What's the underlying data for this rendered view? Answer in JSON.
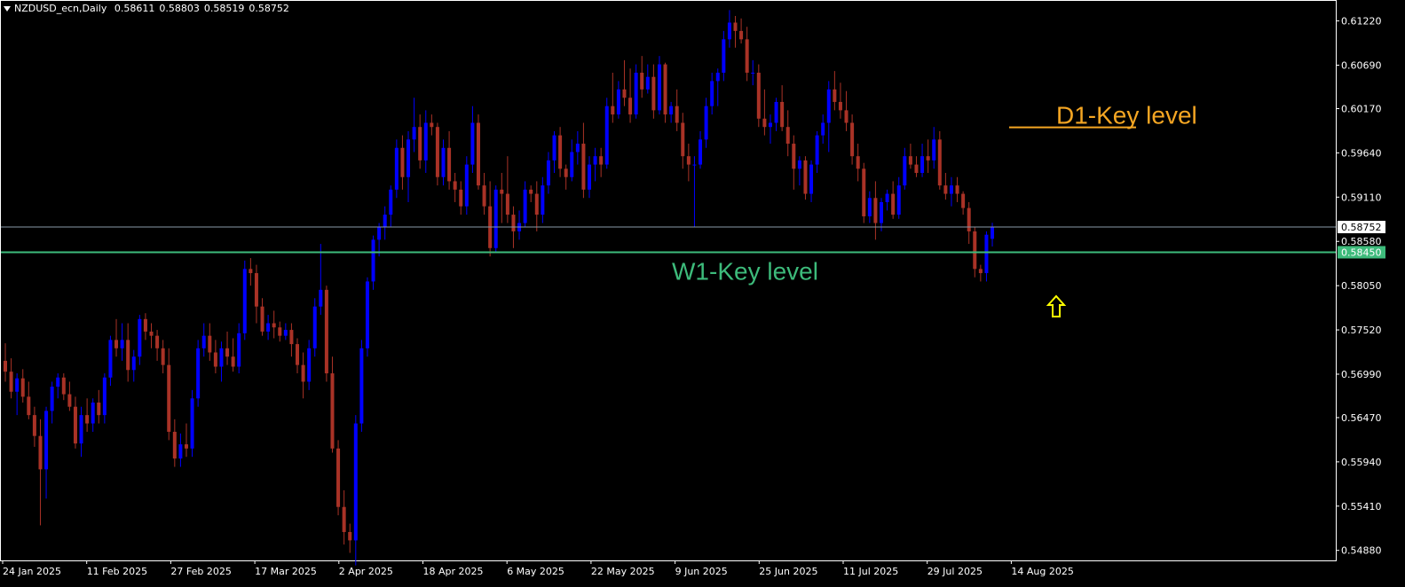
{
  "header": {
    "symbol": "NZDUSD_ecn,Daily",
    "open": "0.58611",
    "high": "0.58803",
    "low": "0.58519",
    "close": "0.58752"
  },
  "chart_data": {
    "type": "candlestick",
    "x_labels": [
      "24 Jan 2025",
      "11 Feb 2025",
      "27 Feb 2025",
      "17 Mar 2025",
      "2 Apr 2025",
      "18 Apr 2025",
      "6 May 2025",
      "22 May 2025",
      "9 Jun 2025",
      "25 Jun 2025",
      "11 Jul 2025",
      "29 Jul 2025",
      "14 Aug 2025"
    ],
    "y_ticks": [
      "0.61220",
      "0.60690",
      "0.60170",
      "0.59640",
      "0.59110",
      "0.58580",
      "0.58050",
      "0.57520",
      "0.56990",
      "0.56470",
      "0.55940",
      "0.55410",
      "0.54880"
    ],
    "ylim": [
      0.5476,
      0.6146
    ],
    "current_price": {
      "value": 0.58752,
      "label": "0.58752"
    },
    "levels": [
      {
        "label": "W1-Key level",
        "value": 0.5845,
        "price_label": "0.58450",
        "color": "#3dbb7b"
      },
      {
        "label": "D1-Key level",
        "value": 0.59946,
        "color": "#f5a623"
      }
    ],
    "colors": {
      "bull": "#0000ff",
      "bear": "#a93226",
      "background": "#000000",
      "text": "#ffffff",
      "arrow": "#ffff00"
    },
    "ohlc": [
      [
        0.5715,
        0.5736,
        0.569,
        0.5702
      ],
      [
        0.5702,
        0.5718,
        0.567,
        0.5678
      ],
      [
        0.5678,
        0.57,
        0.565,
        0.5694
      ],
      [
        0.5694,
        0.5705,
        0.5665,
        0.5672
      ],
      [
        0.5672,
        0.569,
        0.5645,
        0.565
      ],
      [
        0.565,
        0.566,
        0.5612,
        0.5625
      ],
      [
        0.5625,
        0.5645,
        0.5518,
        0.5585
      ],
      [
        0.5585,
        0.566,
        0.555,
        0.5655
      ],
      [
        0.5655,
        0.569,
        0.564,
        0.5684
      ],
      [
        0.5684,
        0.57,
        0.567,
        0.5695
      ],
      [
        0.5695,
        0.57,
        0.5668,
        0.5675
      ],
      [
        0.5675,
        0.569,
        0.5655,
        0.566
      ],
      [
        0.566,
        0.5672,
        0.561,
        0.5616
      ],
      [
        0.5616,
        0.566,
        0.56,
        0.565
      ],
      [
        0.565,
        0.567,
        0.563,
        0.564
      ],
      [
        0.564,
        0.567,
        0.563,
        0.5665
      ],
      [
        0.5665,
        0.568,
        0.564,
        0.565
      ],
      [
        0.565,
        0.57,
        0.564,
        0.5695
      ],
      [
        0.5695,
        0.5745,
        0.5685,
        0.574
      ],
      [
        0.574,
        0.5765,
        0.572,
        0.573
      ],
      [
        0.573,
        0.576,
        0.5715,
        0.574
      ],
      [
        0.574,
        0.576,
        0.569,
        0.5704
      ],
      [
        0.5704,
        0.5728,
        0.569,
        0.572
      ],
      [
        0.572,
        0.577,
        0.571,
        0.5765
      ],
      [
        0.5765,
        0.5772,
        0.574,
        0.575
      ],
      [
        0.575,
        0.576,
        0.573,
        0.5745
      ],
      [
        0.5745,
        0.5752,
        0.5715,
        0.573
      ],
      [
        0.573,
        0.574,
        0.57,
        0.571
      ],
      [
        0.571,
        0.573,
        0.562,
        0.563
      ],
      [
        0.563,
        0.5645,
        0.5588,
        0.5598
      ],
      [
        0.5598,
        0.5628,
        0.5588,
        0.5615
      ],
      [
        0.5615,
        0.564,
        0.56,
        0.561
      ],
      [
        0.561,
        0.568,
        0.56,
        0.567
      ],
      [
        0.567,
        0.574,
        0.566,
        0.573
      ],
      [
        0.573,
        0.576,
        0.572,
        0.5745
      ],
      [
        0.5745,
        0.576,
        0.5715,
        0.5725
      ],
      [
        0.5725,
        0.574,
        0.57,
        0.5708
      ],
      [
        0.5708,
        0.5738,
        0.569,
        0.573
      ],
      [
        0.573,
        0.575,
        0.571,
        0.572
      ],
      [
        0.572,
        0.5742,
        0.5702,
        0.5708
      ],
      [
        0.5708,
        0.576,
        0.57,
        0.5748
      ],
      [
        0.5748,
        0.5835,
        0.574,
        0.5825
      ],
      [
        0.5825,
        0.5838,
        0.5805,
        0.582
      ],
      [
        0.582,
        0.583,
        0.576,
        0.578
      ],
      [
        0.578,
        0.579,
        0.5745,
        0.575
      ],
      [
        0.575,
        0.577,
        0.574,
        0.576
      ],
      [
        0.576,
        0.5775,
        0.5742,
        0.5755
      ],
      [
        0.5755,
        0.5762,
        0.5738,
        0.5745
      ],
      [
        0.5745,
        0.576,
        0.574,
        0.5752
      ],
      [
        0.5752,
        0.576,
        0.572,
        0.5735
      ],
      [
        0.5735,
        0.5742,
        0.57,
        0.571
      ],
      [
        0.571,
        0.5725,
        0.567,
        0.569
      ],
      [
        0.569,
        0.574,
        0.568,
        0.573
      ],
      [
        0.573,
        0.579,
        0.572,
        0.578
      ],
      [
        0.578,
        0.5855,
        0.577,
        0.58
      ],
      [
        0.58,
        0.5805,
        0.569,
        0.57
      ],
      [
        0.57,
        0.572,
        0.5605,
        0.561
      ],
      [
        0.561,
        0.562,
        0.553,
        0.554
      ],
      [
        0.554,
        0.556,
        0.5495,
        0.551
      ],
      [
        0.551,
        0.552,
        0.5485,
        0.55
      ],
      [
        0.55,
        0.565,
        0.547,
        0.564
      ],
      [
        0.564,
        0.574,
        0.563,
        0.573
      ],
      [
        0.573,
        0.5815,
        0.572,
        0.581
      ],
      [
        0.581,
        0.5865,
        0.58,
        0.586
      ],
      [
        0.586,
        0.588,
        0.584,
        0.5875
      ],
      [
        0.5875,
        0.59,
        0.586,
        0.589
      ],
      [
        0.589,
        0.5925,
        0.5875,
        0.592
      ],
      [
        0.592,
        0.598,
        0.591,
        0.597
      ],
      [
        0.597,
        0.5985,
        0.592,
        0.5935
      ],
      [
        0.5935,
        0.599,
        0.5905,
        0.598
      ],
      [
        0.598,
        0.603,
        0.5965,
        0.5995
      ],
      [
        0.5995,
        0.601,
        0.5945,
        0.5955
      ],
      [
        0.5955,
        0.6015,
        0.594,
        0.6
      ],
      [
        0.6,
        0.601,
        0.5985,
        0.5995
      ],
      [
        0.5995,
        0.6,
        0.5925,
        0.5935
      ],
      [
        0.5935,
        0.598,
        0.5925,
        0.597
      ],
      [
        0.597,
        0.599,
        0.592,
        0.593
      ],
      [
        0.593,
        0.594,
        0.5905,
        0.592
      ],
      [
        0.592,
        0.593,
        0.589,
        0.59
      ],
      [
        0.59,
        0.596,
        0.589,
        0.595
      ],
      [
        0.595,
        0.602,
        0.594,
        0.6
      ],
      [
        0.6,
        0.601,
        0.592,
        0.5925
      ],
      [
        0.5925,
        0.594,
        0.589,
        0.59
      ],
      [
        0.59,
        0.593,
        0.584,
        0.585
      ],
      [
        0.585,
        0.5925,
        0.5845,
        0.592
      ],
      [
        0.592,
        0.594,
        0.588,
        0.5915
      ],
      [
        0.5915,
        0.596,
        0.588,
        0.589
      ],
      [
        0.589,
        0.59,
        0.585,
        0.587
      ],
      [
        0.587,
        0.5895,
        0.586,
        0.588
      ],
      [
        0.588,
        0.593,
        0.5875,
        0.592
      ],
      [
        0.592,
        0.5925,
        0.5905,
        0.5915
      ],
      [
        0.5915,
        0.593,
        0.587,
        0.589
      ],
      [
        0.589,
        0.5935,
        0.588,
        0.5925
      ],
      [
        0.5925,
        0.5965,
        0.5915,
        0.5955
      ],
      [
        0.5955,
        0.599,
        0.594,
        0.5985
      ],
      [
        0.5985,
        0.5995,
        0.5935,
        0.5945
      ],
      [
        0.5945,
        0.595,
        0.592,
        0.5935
      ],
      [
        0.5935,
        0.598,
        0.593,
        0.5965
      ],
      [
        0.5965,
        0.599,
        0.595,
        0.5975
      ],
      [
        0.5975,
        0.6,
        0.591,
        0.592
      ],
      [
        0.592,
        0.596,
        0.591,
        0.595
      ],
      [
        0.595,
        0.597,
        0.593,
        0.596
      ],
      [
        0.596,
        0.597,
        0.5935,
        0.595
      ],
      [
        0.595,
        0.603,
        0.5945,
        0.602
      ],
      [
        0.602,
        0.606,
        0.6,
        0.601
      ],
      [
        0.601,
        0.605,
        0.6005,
        0.604
      ],
      [
        0.604,
        0.6075,
        0.602,
        0.603
      ],
      [
        0.603,
        0.6065,
        0.6,
        0.601
      ],
      [
        0.601,
        0.607,
        0.6005,
        0.606
      ],
      [
        0.606,
        0.608,
        0.603,
        0.604
      ],
      [
        0.604,
        0.607,
        0.6035,
        0.6055
      ],
      [
        0.6055,
        0.607,
        0.6005,
        0.6015
      ],
      [
        0.6015,
        0.608,
        0.601,
        0.607
      ],
      [
        0.607,
        0.6072,
        0.6,
        0.601
      ],
      [
        0.601,
        0.6025,
        0.6,
        0.602
      ],
      [
        0.602,
        0.604,
        0.599,
        0.6
      ],
      [
        0.6,
        0.6012,
        0.5945,
        0.596
      ],
      [
        0.596,
        0.5975,
        0.593,
        0.595
      ],
      [
        0.595,
        0.596,
        0.5875,
        0.595
      ],
      [
        0.595,
        0.599,
        0.5945,
        0.598
      ],
      [
        0.598,
        0.603,
        0.597,
        0.602
      ],
      [
        0.602,
        0.606,
        0.601,
        0.605
      ],
      [
        0.605,
        0.6065,
        0.602,
        0.606
      ],
      [
        0.606,
        0.611,
        0.605,
        0.61
      ],
      [
        0.61,
        0.6135,
        0.609,
        0.612
      ],
      [
        0.612,
        0.6128,
        0.609,
        0.611
      ],
      [
        0.611,
        0.6125,
        0.6095,
        0.61
      ],
      [
        0.61,
        0.6115,
        0.605,
        0.606
      ],
      [
        0.606,
        0.6075,
        0.6045,
        0.606
      ],
      [
        0.606,
        0.607,
        0.5995,
        0.6005
      ],
      [
        0.6005,
        0.604,
        0.5985,
        0.5995
      ],
      [
        0.5995,
        0.601,
        0.5975,
        0.6
      ],
      [
        0.6,
        0.603,
        0.599,
        0.6025
      ],
      [
        0.6025,
        0.6045,
        0.599,
        0.5995
      ],
      [
        0.5995,
        0.6015,
        0.596,
        0.5975
      ],
      [
        0.5975,
        0.5985,
        0.592,
        0.5945
      ],
      [
        0.5945,
        0.596,
        0.5925,
        0.5955
      ],
      [
        0.5955,
        0.596,
        0.5908,
        0.5915
      ],
      [
        0.5915,
        0.5955,
        0.5905,
        0.595
      ],
      [
        0.595,
        0.599,
        0.594,
        0.5985
      ],
      [
        0.5985,
        0.601,
        0.5975,
        0.6
      ],
      [
        0.6,
        0.605,
        0.5965,
        0.604
      ],
      [
        0.604,
        0.6062,
        0.6015,
        0.6025
      ],
      [
        0.6025,
        0.6048,
        0.6005,
        0.6015
      ],
      [
        0.6015,
        0.6038,
        0.599,
        0.6
      ],
      [
        0.6,
        0.601,
        0.595,
        0.596
      ],
      [
        0.596,
        0.5975,
        0.593,
        0.5945
      ],
      [
        0.5945,
        0.5952,
        0.588,
        0.5888
      ],
      [
        0.5888,
        0.5918,
        0.588,
        0.591
      ],
      [
        0.591,
        0.593,
        0.586,
        0.588
      ],
      [
        0.588,
        0.591,
        0.587,
        0.5905
      ],
      [
        0.5905,
        0.592,
        0.5895,
        0.5915
      ],
      [
        0.5915,
        0.593,
        0.5885,
        0.589
      ],
      [
        0.589,
        0.5935,
        0.5885,
        0.5925
      ],
      [
        0.5925,
        0.597,
        0.592,
        0.596
      ],
      [
        0.596,
        0.5975,
        0.5945,
        0.595
      ],
      [
        0.595,
        0.596,
        0.5935,
        0.594
      ],
      [
        0.594,
        0.5975,
        0.5935,
        0.596
      ],
      [
        0.596,
        0.598,
        0.594,
        0.5955
      ],
      [
        0.5955,
        0.5995,
        0.5945,
        0.598
      ],
      [
        0.598,
        0.599,
        0.592,
        0.5925
      ],
      [
        0.5925,
        0.594,
        0.5908,
        0.5915
      ],
      [
        0.5915,
        0.5935,
        0.59,
        0.5925
      ],
      [
        0.5925,
        0.5935,
        0.5905,
        0.5915
      ],
      [
        0.5915,
        0.5918,
        0.589,
        0.5898
      ],
      [
        0.5898,
        0.5905,
        0.5855,
        0.587
      ],
      [
        0.587,
        0.5875,
        0.5815,
        0.5825
      ],
      [
        0.5825,
        0.583,
        0.581,
        0.582
      ],
      [
        0.582,
        0.587,
        0.581,
        0.5866
      ],
      [
        0.58611,
        0.58803,
        0.58519,
        0.58752
      ]
    ]
  }
}
